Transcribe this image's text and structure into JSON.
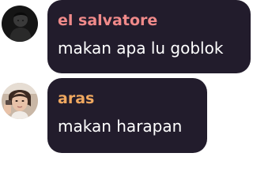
{
  "messages": [
    {
      "author": "el salvatore",
      "author_color": "#f08a8a",
      "text": "makan apa lu goblok",
      "avatar_icon": "avatar-dark-portrait"
    },
    {
      "author": "aras",
      "author_color": "#f0a860",
      "text": "makan harapan",
      "avatar_icon": "avatar-selfie-portrait"
    }
  ],
  "colors": {
    "bubble": "#221c2c",
    "text": "#ffffff",
    "background": "#ffffff"
  }
}
